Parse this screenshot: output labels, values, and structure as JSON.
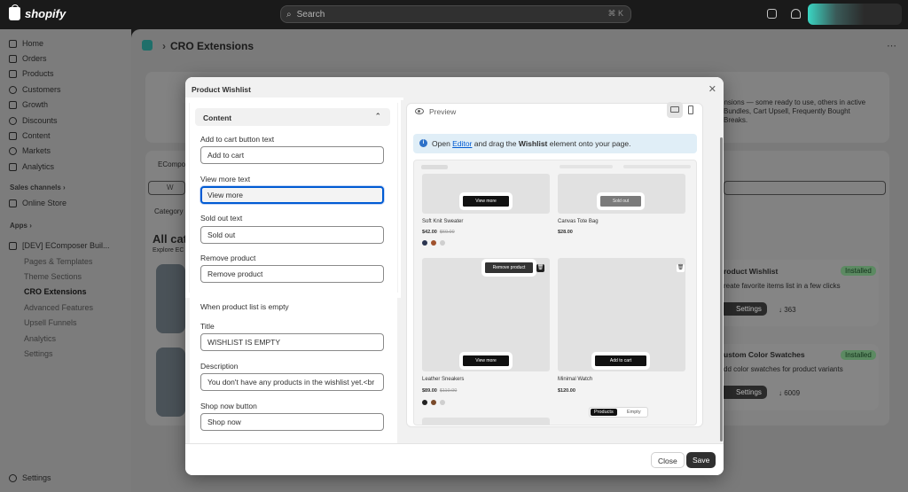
{
  "topbar": {
    "logo": "shopify",
    "search_placeholder": "Search",
    "search_shortcut": "⌘  K"
  },
  "sidebar": {
    "items": [
      {
        "label": "Home"
      },
      {
        "label": "Orders"
      },
      {
        "label": "Products"
      },
      {
        "label": "Customers"
      },
      {
        "label": "Growth"
      },
      {
        "label": "Discounts"
      },
      {
        "label": "Content"
      },
      {
        "label": "Markets"
      },
      {
        "label": "Analytics"
      }
    ],
    "sales_channels_label": "Sales channels ›",
    "online_store": "Online Store",
    "apps_label": "Apps ›",
    "app_name": "[DEV] EComposer Buil...",
    "app_subitems": [
      "Pages & Templates",
      "Theme Sections",
      "CRO Extensions",
      "Advanced Features",
      "Upsell Funnels",
      "Analytics",
      "Settings"
    ],
    "settings": "Settings"
  },
  "page": {
    "breadcrumb_sep": "›",
    "title": "CRO Extensions"
  },
  "background": {
    "intro_text_1": "ensions — some ready to use, others in active",
    "intro_text_2": "Bundles, Cart Upsell, Frequently Bought",
    "intro_text_3": "Breaks.",
    "tab": "EComposer",
    "search_value": "W",
    "category": "Category",
    "all_cat": "All cat",
    "explore": "Explore EC",
    "card1_title": "roduct Wishlist",
    "card1_badge": "Installed",
    "card1_desc": "reate favorite items list in a few clicks",
    "card1_settings": "Settings",
    "card1_count": "363",
    "card2_title": "ustom Color Swatches",
    "card2_badge": "Installed",
    "card2_desc": "dd color swatches for product variants",
    "card2_settings": "Settings",
    "card2_count": "6009"
  },
  "modal": {
    "title": "Product Wishlist",
    "close_label": "Close",
    "save_label": "Save",
    "section_title": "Content",
    "fields": {
      "add_to_cart_label": "Add to cart button text",
      "add_to_cart_value": "Add to cart",
      "view_more_label": "View more text",
      "view_more_value": "View more",
      "sold_out_label": "Sold out text",
      "sold_out_value": "Sold out",
      "remove_label": "Remove product",
      "remove_value": "Remove product",
      "empty_header": "When product list is empty",
      "title_label": "Title",
      "title_value": "WISHLIST IS EMPTY",
      "description_label": "Description",
      "description_value": "You don't have any products in the wishlist yet.<br",
      "shop_now_label": "Shop now button",
      "shop_now_value": "Shop now"
    },
    "preview": {
      "label": "Preview",
      "banner_open": "Open",
      "banner_editor": "Editor",
      "banner_mid": "and drag the",
      "banner_bold": "Wishlist",
      "banner_end": "element onto your page.",
      "products": [
        {
          "name": "Soft Knit Sweater",
          "price": "$42.00",
          "old_price": "$60.00",
          "button": "View more"
        },
        {
          "name": "Canvas Tote Bag",
          "price": "$28.00",
          "button": "Sold out"
        },
        {
          "name": "Leather Sneakers",
          "price": "$89.00",
          "old_price": "$110.00",
          "button": "View more"
        },
        {
          "name": "Minimal Watch",
          "price": "$120.00",
          "button": "Add to cart"
        }
      ],
      "remove_button": "Remove product",
      "toggle_products": "Products",
      "toggle_empty": "Empty"
    }
  },
  "colors": {
    "accent_focus": "#005bd3",
    "installed_badge": "#5c8a62",
    "primary_button": "#303030"
  }
}
